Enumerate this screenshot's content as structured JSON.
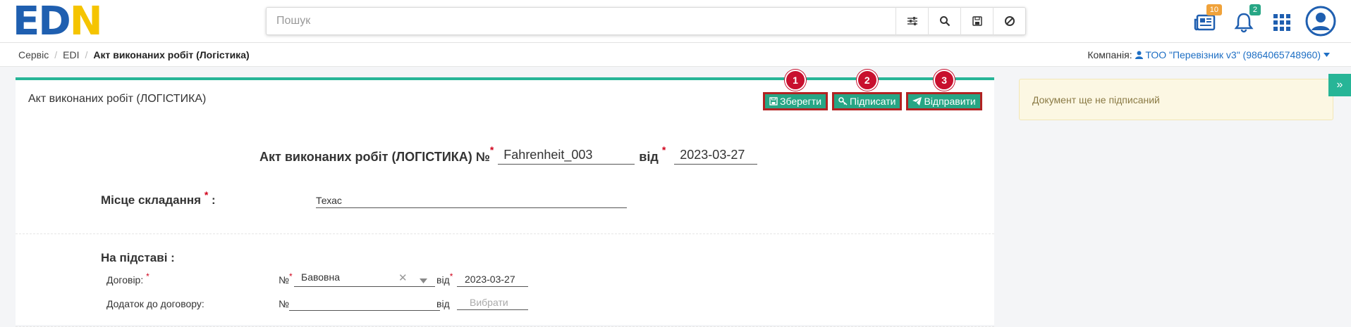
{
  "logo": {
    "part1": "ED",
    "part2": "N"
  },
  "search": {
    "placeholder": "Пошук"
  },
  "header": {
    "news_badge": "10",
    "notifications_badge": "2"
  },
  "breadcrumb": {
    "items": [
      "Сервіс",
      "EDI"
    ],
    "current": "Акт виконаних робіт (Логістика)"
  },
  "company": {
    "label": "Компанія:",
    "name": "ТОО \"Перевізник v3\" (9864065748960)"
  },
  "card": {
    "title": "Акт виконаних робіт (ЛОГІСТИКА)",
    "actions": [
      {
        "num": "1",
        "label": "Зберегти"
      },
      {
        "num": "2",
        "label": "Підписати"
      },
      {
        "num": "3",
        "label": "Відправити"
      }
    ]
  },
  "form": {
    "doc_title": "Акт виконаних робіт (ЛОГІСТИКА) №",
    "doc_number": "Fahrenheit_003",
    "from_label": "від",
    "doc_date": "2023-03-27",
    "place_label": "Місце складання",
    "place_value": "Техас",
    "basis_label": "На підставі :",
    "contract_label": "Договір:",
    "num_sign": "№",
    "contract_value": "Бавовна",
    "contract_from": "від",
    "contract_date": "2023-03-27",
    "addendum_label": "Додаток до договору:",
    "addendum_num_sign": "№",
    "addendum_from": "від",
    "addendum_date_placeholder": "Вибрати"
  },
  "side": {
    "message": "Документ ще не підписаний"
  },
  "colors": {
    "accent": "#27b597",
    "button": "#27a685",
    "highlight": "#b22222",
    "marker": "#c8102e",
    "logo_blue": "#1f5fb0",
    "logo_yellow": "#f5c400"
  }
}
